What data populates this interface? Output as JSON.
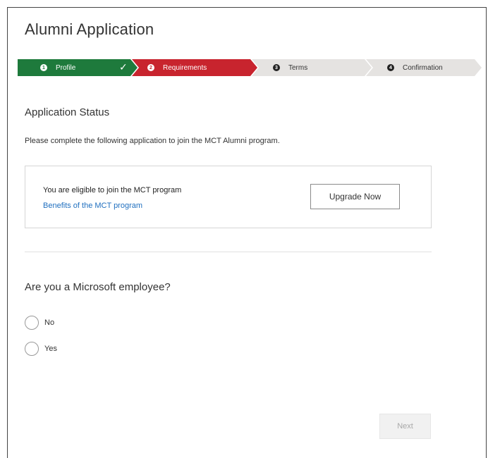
{
  "app": {
    "title": "Alumni Application"
  },
  "stepper": {
    "steps": [
      {
        "number": "1",
        "label": "Profile",
        "state": "completed",
        "color": "#1e7a3c"
      },
      {
        "number": "2",
        "label": "Requirements",
        "state": "active",
        "color": "#c8242e"
      },
      {
        "number": "3",
        "label": "Terms",
        "state": "pending",
        "color": "#e5e3e1"
      },
      {
        "number": "4",
        "label": "Confirmation",
        "state": "pending",
        "color": "#e5e3e1"
      }
    ],
    "completed_icon": "checkmark-icon",
    "completed_glyph": "✓"
  },
  "status": {
    "heading": "Application Status",
    "intro": "Please complete the following application to join the MCT Alumni program."
  },
  "eligibility_card": {
    "message": "You are eligible to join the MCT program",
    "link_text": "Benefits of the MCT program",
    "button_label": "Upgrade Now"
  },
  "question": {
    "text": "Are you a Microsoft employee?",
    "options": [
      {
        "label": "No",
        "selected": false
      },
      {
        "label": "Yes",
        "selected": false
      }
    ]
  },
  "footer": {
    "next_label": "Next",
    "next_enabled": false
  }
}
